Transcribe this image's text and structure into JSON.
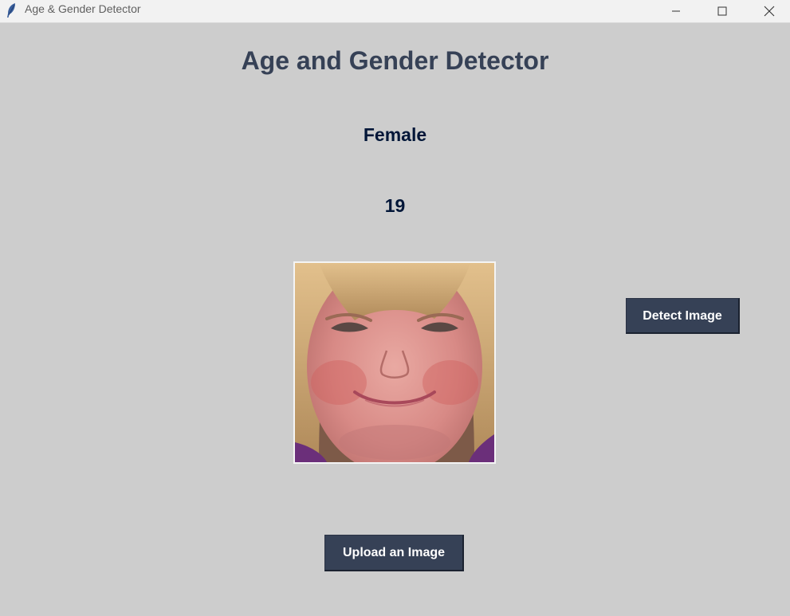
{
  "window": {
    "title": "Age & Gender Detector",
    "icon": "feather-icon",
    "controls": [
      "minimize-icon",
      "maximize-icon",
      "close-icon"
    ]
  },
  "main": {
    "heading": "Age and Gender Detector",
    "gender_result": "Female",
    "age_result": "19",
    "photo": "uploaded-face-photo"
  },
  "buttons": {
    "detect_label": "Detect Image",
    "upload_label": "Upload an Image"
  },
  "colors": {
    "background": "#cdcdcd",
    "heading": "#364156",
    "result_text": "#011638",
    "button_bg": "#364156",
    "button_text": "#ffffff"
  }
}
